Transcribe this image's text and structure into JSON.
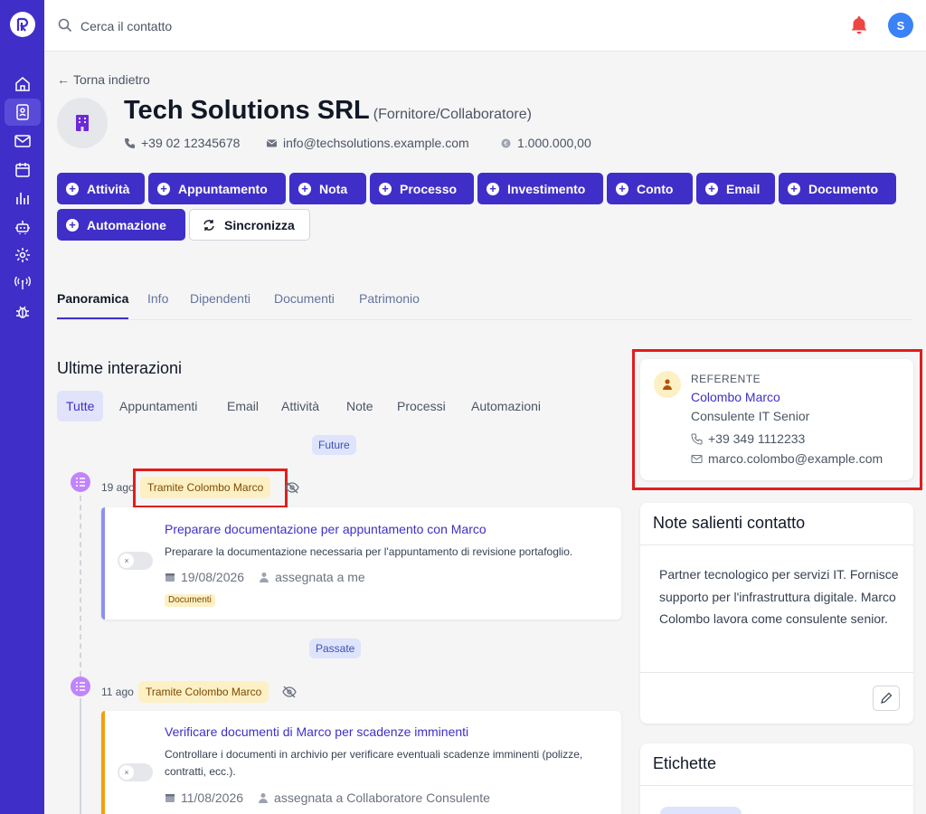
{
  "search": {
    "placeholder": "Cerca il contatto"
  },
  "user": {
    "initial": "S"
  },
  "back_label": "Torna indietro",
  "company": {
    "name": "Tech Solutions SRL",
    "type": "(Fornitore/Collaboratore)",
    "phone": "+39 02 12345678",
    "email": "info@techsolutions.example.com",
    "capital": "1.000.000,00"
  },
  "actions": [
    "Attività",
    "Appuntamento",
    "Nota",
    "Processo",
    "Investimento",
    "Conto",
    "Email",
    "Documento",
    "Automazione"
  ],
  "sync_label": "Sincronizza",
  "tabs": [
    "Panoramica",
    "Info",
    "Dipendenti",
    "Documenti",
    "Patrimonio"
  ],
  "interactions": {
    "title": "Ultime interazioni",
    "filters": [
      "Tutte",
      "Appuntamenti",
      "Email",
      "Attività",
      "Note",
      "Processi",
      "Automazioni"
    ],
    "future_label": "Future",
    "past_label": "Passate",
    "items": [
      {
        "date": "19 ago",
        "via": "Tramite Colombo Marco",
        "title": "Preparare documentazione per appuntamento con Marco",
        "description": "Preparare la documentazione necessaria per l'appuntamento di revisione portafoglio.",
        "due": "19/08/2026",
        "assignee": "assegnata a me",
        "tag": "Documenti"
      },
      {
        "date": "11 ago",
        "via": "Tramite Colombo Marco",
        "title": "Verificare documenti di Marco per scadenze imminenti",
        "description": "Controllare i documenti in archivio per verificare eventuali scadenze imminenti (polizze, contratti, ecc.).",
        "due": "11/08/2026",
        "assignee": "assegnata a Collaboratore Consulente"
      }
    ]
  },
  "referent": {
    "label": "REFERENTE",
    "name": "Colombo Marco",
    "role": "Consulente IT Senior",
    "phone": "+39 349 1112233",
    "email": "marco.colombo@example.com"
  },
  "notes": {
    "title": "Note salienti contatto",
    "text": "Partner tecnologico per servizi IT. Fornisce supporto per l'infrastruttura digitale. Marco Colombo lavora come consulente senior."
  },
  "labels_card": {
    "title": "Etichette"
  },
  "colors": {
    "brand": "#3f2fc8",
    "highlight": "#e11d1d",
    "bell": "#ef4444"
  }
}
